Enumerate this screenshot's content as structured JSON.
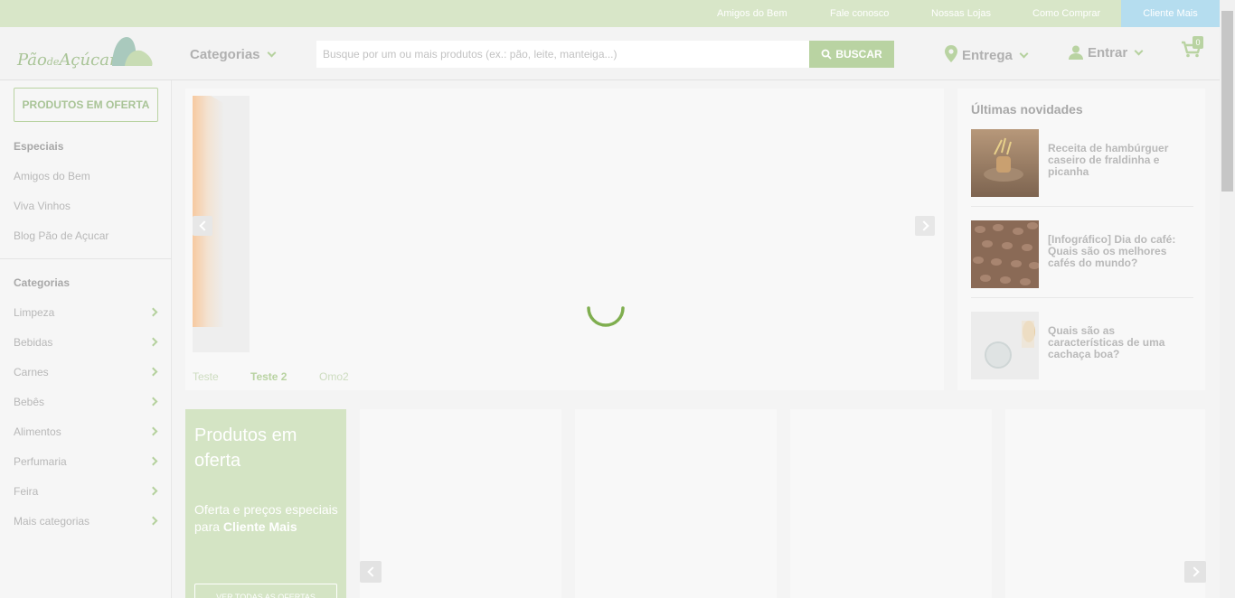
{
  "topbar": {
    "links": [
      "Amigos do Bem",
      "Fale conosco",
      "Nossas Lojas",
      "Como Comprar"
    ],
    "cliente_mais": "Cliente Mais"
  },
  "header": {
    "logo": {
      "part1": "Pão",
      "part2": "de",
      "part3": "Açúcar"
    },
    "categorias": "Categorias",
    "search_placeholder": "Busque por um ou mais produtos (ex.: pão, leite, manteiga...)",
    "search_button": "BUSCAR",
    "entrega": "Entrega",
    "entrar": "Entrar",
    "cart_count": "0"
  },
  "sidebar": {
    "oferta_button": "PRODUTOS EM OFERTA",
    "especiais_title": "Especiais",
    "especiais": [
      "Amigos do Bem",
      "Viva Vinhos",
      "Blog Pão de Açucar"
    ],
    "categorias_title": "Categorias",
    "categorias": [
      "Limpeza",
      "Bebidas",
      "Carnes",
      "Bebês",
      "Alimentos",
      "Perfumaria",
      "Feira",
      "Mais categorias"
    ]
  },
  "banner": {
    "tabs": [
      "Teste",
      "Teste 2",
      "Omo2"
    ],
    "active_tab": "Teste 2"
  },
  "news": {
    "title": "Últimas novidades",
    "items": [
      {
        "title": "Receita de hambúrguer caseiro de fraldinha e picanha"
      },
      {
        "title": "[Infográfico] Dia do café: Quais são os melhores cafés do mundo?"
      },
      {
        "title": "Quais são as características de uma cachaça boa?"
      }
    ]
  },
  "offers": {
    "title": "Produtos em oferta",
    "desc_prefix": "Oferta e preços especiais para ",
    "desc_bold": "Cliente Mais",
    "cta": "VER TODAS AS OFERTAS"
  },
  "colors": {
    "brand_green": "#b9d3a2",
    "topbar_bg": "#d8e6c8",
    "cliente_mais_bg": "#b5ddef",
    "offer_panel_bg": "#d4e4c4"
  }
}
